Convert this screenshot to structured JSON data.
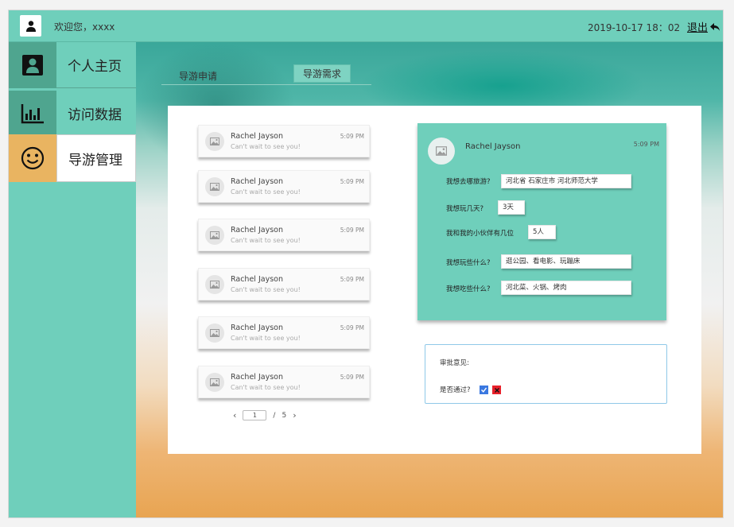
{
  "header": {
    "welcome": "欢迎您，xxxx",
    "datetime": "2019-10-17   18：02",
    "logout_label": "退出"
  },
  "sidebar": {
    "items": [
      {
        "label": "个人主页",
        "icon": "user-card-icon"
      },
      {
        "label": "访问数据",
        "icon": "bar-chart-icon"
      },
      {
        "label": "导游管理",
        "icon": "smiley-icon",
        "active": true
      }
    ]
  },
  "tabs": [
    {
      "label": "导游申请"
    },
    {
      "label": "导游需求",
      "active": true
    }
  ],
  "messages": [
    {
      "name": "Rachel Jayson",
      "text": "Can't wait to see you!",
      "time": "5:09 PM"
    },
    {
      "name": "Rachel Jayson",
      "text": "Can't wait to see you!",
      "time": "5:09 PM"
    },
    {
      "name": "Rachel Jayson",
      "text": "Can't wait to see you!",
      "time": "5:09 PM"
    },
    {
      "name": "Rachel Jayson",
      "text": "Can't wait to see you!",
      "time": "5:09 PM"
    },
    {
      "name": "Rachel Jayson",
      "text": "Can't wait to see you!",
      "time": "5:09 PM"
    },
    {
      "name": "Rachel Jayson",
      "text": "Can't wait to see you!",
      "time": "5:09 PM"
    }
  ],
  "pager": {
    "current": "1",
    "separator": "/",
    "total": "5"
  },
  "detail": {
    "name": "Rachel Jayson",
    "time": "5:09 PM",
    "fields": [
      {
        "label": "我想去哪旅游?",
        "value": "河北省 石家庄市 河北师范大学"
      },
      {
        "label": "我想玩几天?",
        "value": "3天"
      },
      {
        "label": "我和我的小伙伴有几位",
        "value": "5人"
      },
      {
        "label": "我想玩些什么?",
        "value": "逛公园、看电影、玩蹦床"
      },
      {
        "label": "我想吃些什么?",
        "value": "河北菜、火锅、烤肉"
      }
    ]
  },
  "approval": {
    "opinion_label": "审批意见:",
    "pass_label": "是否通过?"
  },
  "colors": {
    "accent": "#6fcfbb",
    "active_nav": "#e9b461",
    "approve": "#3a78e0",
    "reject": "#e8202a"
  }
}
